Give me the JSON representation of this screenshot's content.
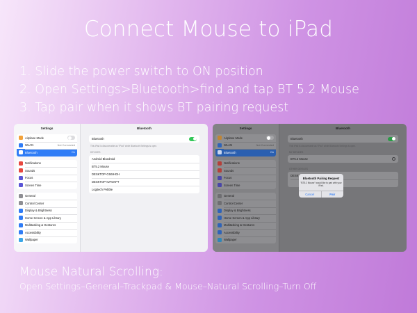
{
  "title": "Connect Mouse to iPad",
  "steps": [
    "1. Slide the power switch to ON position",
    "2. Open Settings>Bluetooth>find and tap BT 5.2 Mouse",
    "3. Tap pair when it shows BT pairing request"
  ],
  "scrolling": {
    "title": "Mouse Natural Scrolling:",
    "path": "Open Settings–General–Trackpad & Mouse–Natural Scrolling–Turn Off"
  },
  "colors": {
    "accent": "#2f7cf6",
    "toggle_on": "#34c759"
  },
  "screen_left": {
    "sidebar_title": "Settings",
    "main_title": "Bluetooth",
    "group1": [
      {
        "label": "Airplane Mode",
        "icon": "airplane-icon",
        "color": "#f3a23a",
        "value": ""
      },
      {
        "label": "WLAN",
        "icon": "wifi-icon",
        "color": "#2f7cf6",
        "value": "Not Connected"
      },
      {
        "label": "Bluetooth",
        "icon": "bluetooth-icon",
        "color": "#2f7cf6",
        "value": "On"
      }
    ],
    "group2": [
      {
        "label": "Notifications",
        "icon": "notifications-icon",
        "color": "#e8483f"
      },
      {
        "label": "Sounds",
        "icon": "sounds-icon",
        "color": "#e8483f"
      },
      {
        "label": "Focus",
        "icon": "focus-icon",
        "color": "#5a55d6"
      },
      {
        "label": "Screen Time",
        "icon": "screen-time-icon",
        "color": "#5a55d6"
      }
    ],
    "group3": [
      {
        "label": "General",
        "icon": "gear-icon",
        "color": "#8e8e93"
      },
      {
        "label": "Control Center",
        "icon": "control-center-icon",
        "color": "#8e8e93"
      },
      {
        "label": "Display & Brightness",
        "icon": "display-icon",
        "color": "#2f7cf6"
      },
      {
        "label": "Home Screen & App Library",
        "icon": "home-screen-icon",
        "color": "#2f7cf6"
      },
      {
        "label": "Multitasking & Gestures",
        "icon": "multitasking-icon",
        "color": "#2f7cf6"
      },
      {
        "label": "Accessibility",
        "icon": "accessibility-icon",
        "color": "#2f7cf6"
      },
      {
        "label": "Wallpaper",
        "icon": "wallpaper-icon",
        "color": "#3aa7e8"
      }
    ],
    "bt_label": "Bluetooth",
    "bt_note": "This iPad is discoverable as \"iPad\" while Bluetooth Settings is open.",
    "devices_header": "DEVICES",
    "devices": [
      "Android Bluedroid",
      "BT5.2 Mouse",
      "DESKTOP-GS6IHGH",
      "DESKTOP-IUFGKPT",
      "Logitech Pebble"
    ]
  },
  "screen_right": {
    "sidebar_title": "Settings",
    "main_title": "Bluetooth",
    "group1": [
      {
        "label": "Airplane Mode",
        "icon": "airplane-icon",
        "color": "#c08534",
        "value": ""
      },
      {
        "label": "WLAN",
        "icon": "wifi-icon",
        "color": "#2f63b8",
        "value": "Not Connected"
      },
      {
        "label": "Bluetooth",
        "icon": "bluetooth-icon",
        "color": "#2f63b8",
        "value": "On"
      }
    ],
    "group2": [
      {
        "label": "Notifications",
        "icon": "notifications-icon",
        "color": "#b5403a"
      },
      {
        "label": "Sounds",
        "icon": "sounds-icon",
        "color": "#b5403a"
      },
      {
        "label": "Focus",
        "icon": "focus-icon",
        "color": "#4a46a8"
      },
      {
        "label": "Screen Time",
        "icon": "screen-time-icon",
        "color": "#4a46a8"
      }
    ],
    "group3": [
      {
        "label": "General",
        "icon": "gear-icon",
        "color": "#6e6e72"
      },
      {
        "label": "Control Center",
        "icon": "control-center-icon",
        "color": "#6e6e72"
      },
      {
        "label": "Display & Brightness",
        "icon": "display-icon",
        "color": "#2f63b8"
      },
      {
        "label": "Home Screen & App Library",
        "icon": "home-screen-icon",
        "color": "#2f63b8"
      },
      {
        "label": "Multitasking & Gestures",
        "icon": "multitasking-icon",
        "color": "#2f63b8"
      },
      {
        "label": "Accessibility",
        "icon": "accessibility-icon",
        "color": "#2f63b8"
      },
      {
        "label": "Wallpaper",
        "icon": "wallpaper-icon",
        "color": "#2f86b8"
      }
    ],
    "bt_label": "Bluetooth",
    "bt_note": "This iPad is discoverable as \"iPad\" while Bluetooth Settings is open.",
    "my_devices_header": "MY DEVICES",
    "my_devices": [
      "BT5.2 Mouse"
    ],
    "other_devices_header": "OTHER DEVICES",
    "other_devices": [
      "DESKTOP-GS6IHGH"
    ],
    "dialog": {
      "title": "Bluetooth Pairing Request",
      "text": "\"BT5.2 Mouse\" would like to pair with your iPad.",
      "cancel": "Cancel",
      "pair": "Pair"
    }
  }
}
